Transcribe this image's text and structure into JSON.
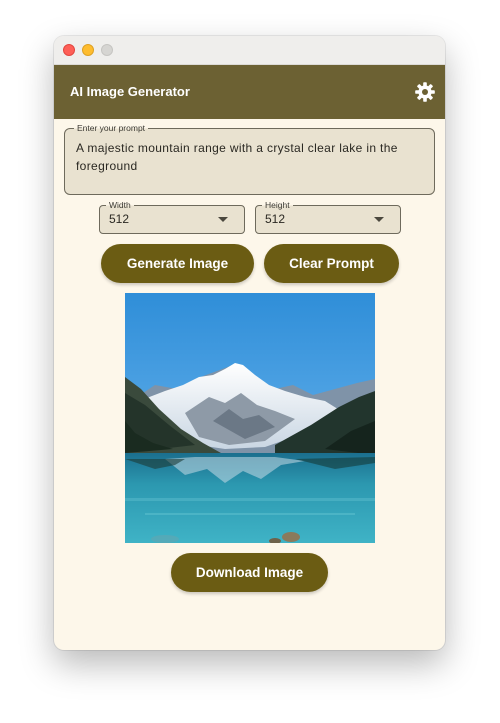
{
  "window": {
    "controls": [
      "close",
      "minimize",
      "maximize"
    ]
  },
  "appbar": {
    "title": "AI Image Generator",
    "settings_icon": "gear-icon",
    "color": "#6c6133"
  },
  "prompt": {
    "label": "Enter your prompt",
    "value": "A majestic mountain range with a crystal clear lake in the foreground"
  },
  "size": {
    "width": {
      "label": "Width",
      "value": "512"
    },
    "height": {
      "label": "Height",
      "value": "512"
    }
  },
  "actions": {
    "generate_label": "Generate Image",
    "clear_label": "Clear Prompt",
    "download_label": "Download Image",
    "button_color": "#6b5c13"
  },
  "image": {
    "alt": "Generated image: snow-capped mountains above a turquoise lake"
  }
}
